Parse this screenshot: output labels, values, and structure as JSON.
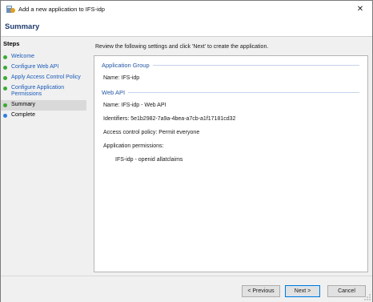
{
  "window": {
    "title": "Add a new application to IFS-idp",
    "close_glyph": "✕"
  },
  "header": {
    "title": "Summary"
  },
  "steps": {
    "heading": "Steps",
    "items": [
      {
        "label": "Welcome",
        "status": "done"
      },
      {
        "label": "Configure Web API",
        "status": "done"
      },
      {
        "label": "Apply Access Control Policy",
        "status": "done"
      },
      {
        "label": "Configure Application Permissions",
        "status": "done"
      },
      {
        "label": "Summary",
        "status": "current"
      },
      {
        "label": "Complete",
        "status": "pending"
      }
    ]
  },
  "main": {
    "instruction": "Review the following settings and click 'Next' to create the application.",
    "application_group": {
      "title": "Application Group",
      "name": "Name: IFS-idp"
    },
    "web_api": {
      "title": "Web API",
      "name": "Name: IFS-idp - Web API",
      "identifiers": "Identifiers: 5e1b2982-7a9a-4bea-a7cb-a1f17181cd32",
      "policy": "Access control policy: Permit everyone",
      "permissions_label": "Application permissions:",
      "permissions_value": "IFS-idp - openid allatclaims"
    }
  },
  "footer": {
    "previous_label": "< Previous",
    "next_label": "Next >",
    "cancel_label": "Cancel"
  },
  "colors": {
    "accent": "#0078d7",
    "done": "#3ba935",
    "pending": "#2f7de1",
    "group_title": "#2456a4"
  }
}
